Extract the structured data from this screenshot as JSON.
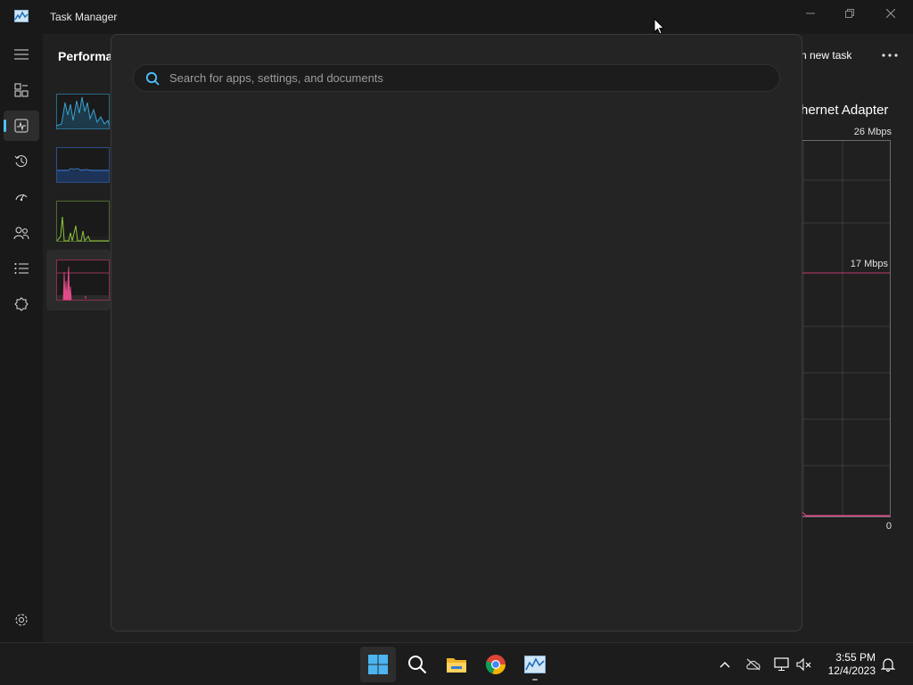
{
  "window": {
    "title": "Task Manager",
    "controls": {
      "minimize_icon": "minimize-icon",
      "restore_icon": "restore-icon",
      "close_icon": "close-icon"
    }
  },
  "nav": {
    "items": [
      {
        "icon": "hamburger-menu-icon"
      },
      {
        "icon": "processes-icon"
      },
      {
        "icon": "performance-icon",
        "active": true
      },
      {
        "icon": "app-history-icon"
      },
      {
        "icon": "startup-apps-icon"
      },
      {
        "icon": "users-icon"
      },
      {
        "icon": "details-icon"
      },
      {
        "icon": "services-icon"
      }
    ],
    "settings_icon": "gear-icon"
  },
  "header": {
    "page_title": "Performance",
    "page_title_visible": "Performa",
    "run_new_task": "n new task",
    "more_icon": "more-dots-icon"
  },
  "detail": {
    "title": "hernet Adapter",
    "max_label": "26 Mbps",
    "mid_label": "17 Mbps",
    "min_label": "0"
  },
  "search": {
    "placeholder": "Search for apps, settings, and documents",
    "value": ""
  },
  "taskbar": {
    "apps": [
      {
        "name": "start",
        "icon": "windows-start-icon",
        "active": true
      },
      {
        "name": "search",
        "icon": "search-icon"
      },
      {
        "name": "file-explorer",
        "icon": "folder-icon"
      },
      {
        "name": "chrome",
        "icon": "chrome-icon"
      },
      {
        "name": "task-manager",
        "icon": "task-manager-icon",
        "running": true
      }
    ],
    "tray": [
      {
        "icon": "chevron-up-icon"
      },
      {
        "icon": "onedrive-offline-icon"
      },
      {
        "icon": "network-icon"
      },
      {
        "icon": "volume-muted-icon"
      }
    ],
    "time": "3:55 PM",
    "date": "12/4/2023",
    "notification_icon": "bell-icon"
  },
  "colors": {
    "accent": "#4cc2ff",
    "cpu_graph": "#3aa0d0",
    "memory_graph": "#3a7fd6",
    "disk_graph": "#8cc43c",
    "network_graph": "#e24b8a"
  }
}
